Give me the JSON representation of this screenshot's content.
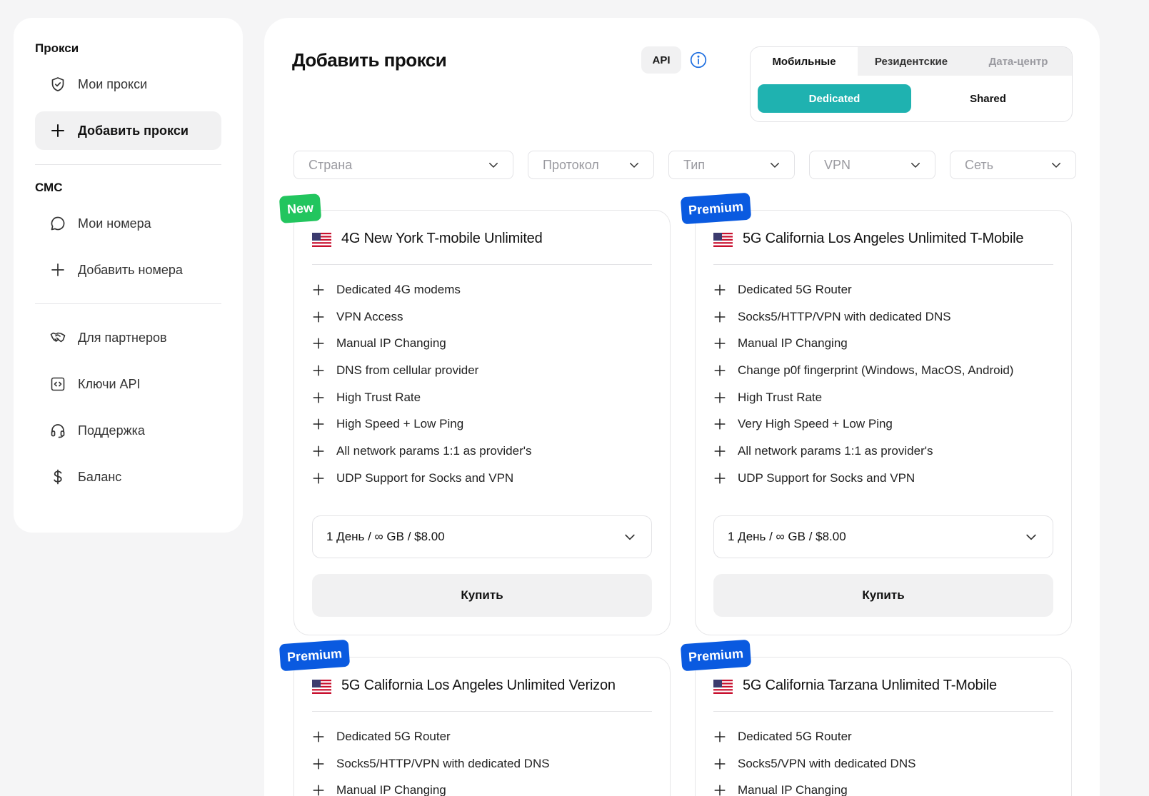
{
  "sidebar": {
    "section_proxy": "Прокси",
    "my_proxies": "Мои прокси",
    "add_proxies": "Добавить прокси",
    "section_sms": "СМС",
    "my_numbers": "Мои номера",
    "add_numbers": "Добавить номера",
    "partners": "Для партнеров",
    "api_keys": "Ключи API",
    "support": "Поддержка",
    "balance": "Баланс"
  },
  "header": {
    "title": "Добавить прокси",
    "api_label": "API"
  },
  "type_tabs": [
    "Мобильные",
    "Резидентские",
    "Дата-центр"
  ],
  "sub_tabs": [
    "Dedicated",
    "Shared"
  ],
  "filters": [
    "Страна",
    "Протокол",
    "Тип",
    "VPN",
    "Сеть"
  ],
  "cards": [
    {
      "badge": "New",
      "title": "4G New York T-mobile Unlimited",
      "features": [
        "Dedicated 4G modems",
        "VPN Access",
        "Manual IP Changing",
        "DNS from cellular provider",
        "High Trust Rate",
        "High Speed + Low Ping",
        "All network params 1:1 as provider's",
        "UDP Support for Socks and VPN"
      ],
      "price": "1 День / ∞ GB / $8.00",
      "buy": "Купить"
    },
    {
      "badge": "Premium",
      "title": "5G California Los Angeles Unlimited T-Mobile",
      "features": [
        "Dedicated 5G Router",
        "Socks5/HTTP/VPN with dedicated DNS",
        "Manual IP Changing",
        "Change p0f fingerprint (Windows, MacOS, Android)",
        "High Trust Rate",
        "Very High Speed + Low Ping",
        "All network params 1:1 as provider's",
        "UDP Support for Socks and VPN"
      ],
      "price": "1 День / ∞ GB / $8.00",
      "buy": "Купить"
    },
    {
      "badge": "Premium",
      "title": "5G California Los Angeles Unlimited Verizon",
      "features": [
        "Dedicated 5G Router",
        "Socks5/HTTP/VPN with dedicated DNS",
        "Manual IP Changing"
      ]
    },
    {
      "badge": "Premium",
      "title": "5G California Tarzana Unlimited T-Mobile",
      "features": [
        "Dedicated 5G Router",
        "Socks5/VPN with dedicated DNS",
        "Manual IP Changing"
      ]
    }
  ],
  "colors": {
    "accent": "#1fb2b0",
    "badge_new": "#22c55e",
    "badge_premium": "#0a5ae0",
    "info_icon": "#1f6fe0"
  }
}
